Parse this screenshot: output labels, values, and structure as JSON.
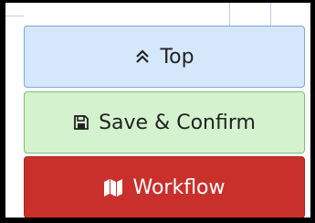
{
  "buttons": {
    "top": {
      "label": "Top",
      "icon": "double-chevron-up-icon"
    },
    "save": {
      "label": "Save & Confirm",
      "icon": "floppy-disk-icon"
    },
    "workflow": {
      "label": "Workflow",
      "icon": "map-icon"
    }
  },
  "colors": {
    "top_bg": "#d5e8fb",
    "save_bg": "#d5f2cf",
    "workflow_bg": "#c9302c"
  }
}
